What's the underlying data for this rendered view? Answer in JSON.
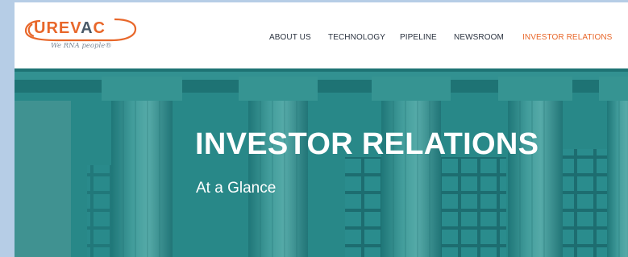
{
  "logo": {
    "wordmark_left": "UREV",
    "wordmark_mid": "A",
    "wordmark_right": "C",
    "tagline": "We RNA people®",
    "colors": {
      "orange": "#e8672a",
      "slate": "#4a5a68"
    }
  },
  "nav": {
    "items": [
      {
        "label": "ABOUT US"
      },
      {
        "label": "TECHNOLOGY"
      },
      {
        "label": "PIPELINE"
      },
      {
        "label": "NEWSROOM"
      },
      {
        "label": "INVESTOR RELATIONS",
        "active": true
      }
    ]
  },
  "hero": {
    "title": "INVESTOR RELATIONS",
    "subtitle": "At a Glance",
    "overlay_color": "#2b8a8a"
  }
}
